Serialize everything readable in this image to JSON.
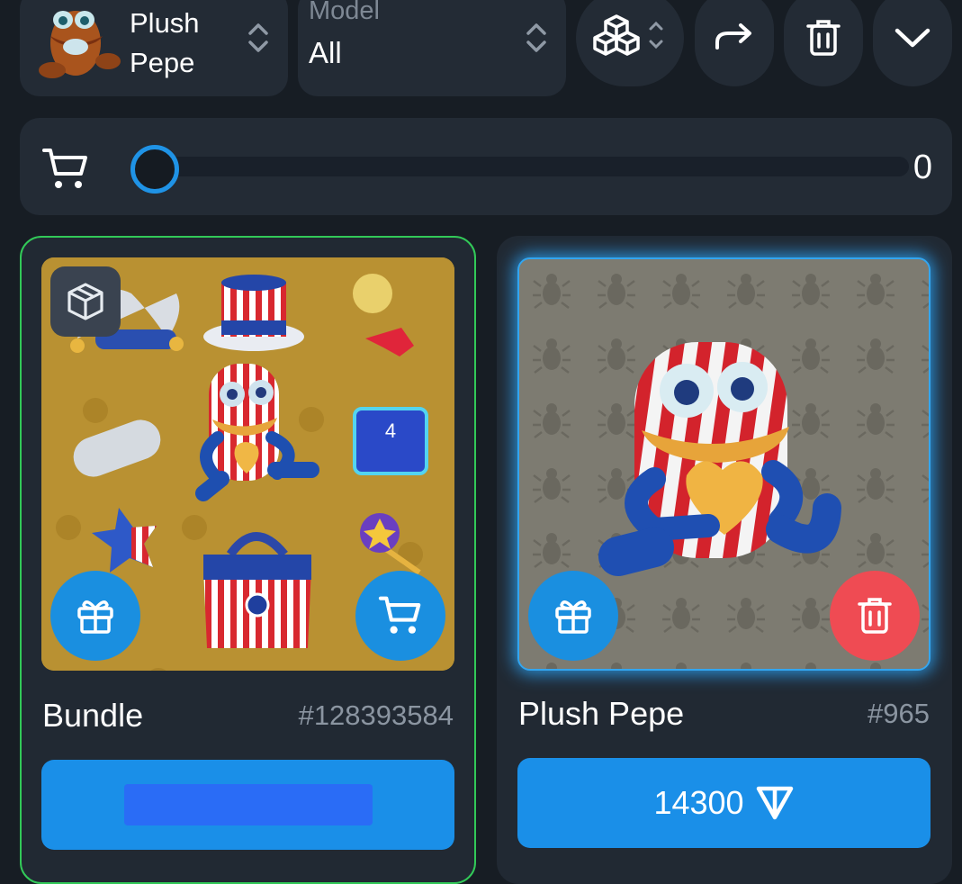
{
  "filters": {
    "collection": {
      "name": "Plush Pepe",
      "icon": "plush-pepe-thumbnail"
    },
    "model": {
      "label": "Model",
      "value": "All"
    }
  },
  "toolbar": {
    "icons": [
      "cubes-icon",
      "share-arrow-icon",
      "trash-icon",
      "chevron-down-icon"
    ]
  },
  "cart": {
    "icon": "cart-icon",
    "count": "0",
    "slider_value": 0
  },
  "cards": [
    {
      "title": "Bundle",
      "number": "#128393584",
      "badge_icon": "box-icon",
      "actions": [
        "gift-icon",
        "cart-icon"
      ],
      "button_label": "",
      "accent": "#32c958"
    },
    {
      "title": "Plush Pepe",
      "number": "#965",
      "actions": [
        "gift-icon",
        "trash-icon"
      ],
      "price": "14300",
      "currency_icon": "ton-icon",
      "accent": "#33a6f0"
    }
  ],
  "colors": {
    "background": "#171d24",
    "panel": "#232b35",
    "primary": "#1a8fe8",
    "danger": "#ef4b53"
  }
}
